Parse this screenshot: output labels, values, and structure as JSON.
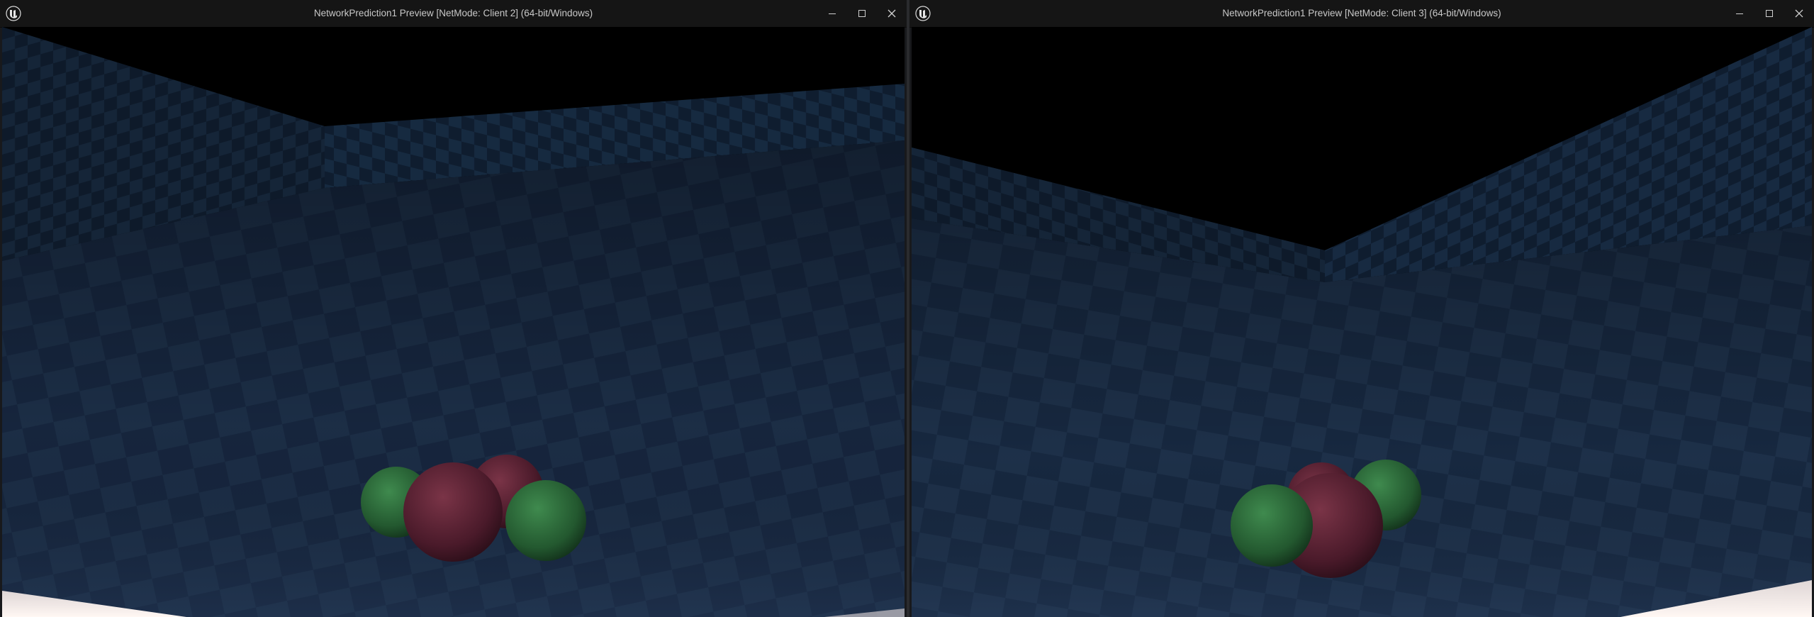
{
  "windows": [
    {
      "title": "NetworkPrediction1 Preview [NetMode: Client 2]  (64-bit/Windows)",
      "logo_icon": "unreal-engine-logo-icon",
      "controls": [
        "minimize-icon",
        "maximize-icon",
        "close-icon"
      ]
    },
    {
      "title": "NetworkPrediction1 Preview [NetMode: Client 3]  (64-bit/Windows)",
      "logo_icon": "unreal-engine-logo-icon",
      "controls": [
        "minimize-icon",
        "maximize-icon",
        "close-icon"
      ]
    }
  ],
  "colors": {
    "titlebar": "#151515",
    "title_text": "#c8c8c8",
    "floor": "#1b2d45",
    "wall": "#15253a",
    "sky": "#000000",
    "ball_red": "#5a2233",
    "ball_green": "#2c6a3a",
    "glow": "#f3e6e2"
  }
}
